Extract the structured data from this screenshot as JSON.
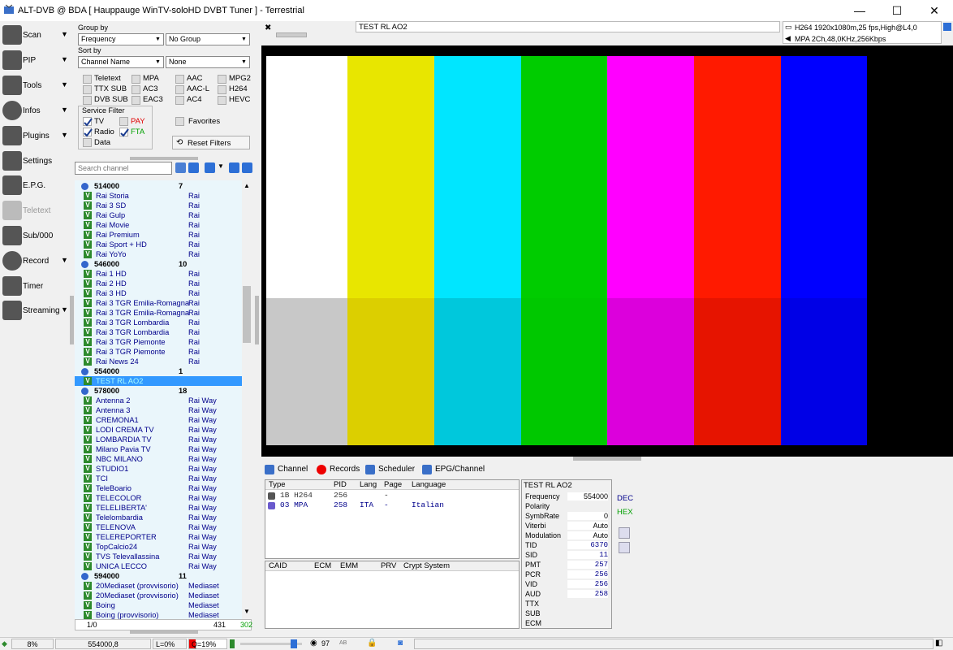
{
  "window": {
    "title": "ALT-DVB @ BDA [ Hauppauge WinTV-soloHD DVBT Tuner ] - Terrestrial",
    "minimize": "—",
    "maximize": "☐",
    "close": "✕"
  },
  "left_panel": [
    {
      "label": "Scan",
      "icon": "satellite-dish-icon",
      "arrow": "▼"
    },
    {
      "label": "PIP",
      "icon": "monitor-icon",
      "arrow": "▼"
    },
    {
      "label": "Tools",
      "icon": "tools-icon",
      "arrow": "▼"
    },
    {
      "label": "Infos",
      "icon": "info-icon",
      "arrow": "▼"
    },
    {
      "label": "Plugins",
      "icon": "plugin-icon",
      "arrow": "▼"
    },
    {
      "label": "Settings",
      "icon": "gear-icon",
      "arrow": ""
    },
    {
      "label": "E.P.G.",
      "icon": "epg-icon",
      "arrow": ""
    },
    {
      "label": "Teletext",
      "icon": "teletext-icon",
      "arrow": ""
    },
    {
      "label": "Sub/000",
      "icon": "subtitle-icon",
      "arrow": ""
    },
    {
      "label": "Record",
      "icon": "record-icon",
      "arrow": "▼"
    },
    {
      "label": "Timer",
      "icon": "clock-icon",
      "arrow": ""
    },
    {
      "label": "Streaming",
      "icon": "network-icon",
      "arrow": "▼"
    }
  ],
  "filters": {
    "group_by_label": "Group by",
    "group_by_value": "Frequency",
    "group_by2_value": "No Group",
    "sort_by_label": "Sort by",
    "sort_by_value": "Channel Name",
    "sort_by2_value": "None",
    "checkboxes": [
      "Teletext",
      "MPA",
      "AAC",
      "MPG2",
      "TTX SUB",
      "AC3",
      "AAC-L",
      "H264",
      "DVB SUB",
      "EAC3",
      "AC4",
      "HEVC"
    ],
    "service_filter_label": "Service Filter",
    "tv": "TV",
    "pay": "PAY",
    "radio": "Radio",
    "fta": "FTA",
    "data": "Data",
    "favorites": "Favorites",
    "reset": "Reset Filters"
  },
  "search": {
    "placeholder": "Search channel"
  },
  "channels": [
    {
      "type": "group",
      "name": "514000",
      "count": "7"
    },
    {
      "name": "Rai  Storia",
      "provider": "Rai"
    },
    {
      "name": "Rai 3 SD",
      "provider": "Rai"
    },
    {
      "name": "Rai Gulp",
      "provider": "Rai"
    },
    {
      "name": "Rai Movie",
      "provider": "Rai"
    },
    {
      "name": "Rai Premium",
      "provider": "Rai"
    },
    {
      "name": "Rai Sport + HD",
      "provider": "Rai"
    },
    {
      "name": "Rai YoYo",
      "provider": "Rai"
    },
    {
      "type": "group",
      "name": "546000",
      "count": "10"
    },
    {
      "name": "Rai 1 HD",
      "provider": "Rai"
    },
    {
      "name": "Rai 2 HD",
      "provider": "Rai"
    },
    {
      "name": "Rai 3 HD",
      "provider": "Rai"
    },
    {
      "name": "Rai 3 TGR Emilia-Romagna",
      "provider": "Rai"
    },
    {
      "name": "Rai 3 TGR Emilia-Romagna",
      "provider": "Rai"
    },
    {
      "name": "Rai 3 TGR Lombardia",
      "provider": "Rai"
    },
    {
      "name": "Rai 3 TGR Lombardia",
      "provider": "Rai"
    },
    {
      "name": "Rai 3 TGR Piemonte",
      "provider": "Rai"
    },
    {
      "name": "Rai 3 TGR Piemonte",
      "provider": "Rai"
    },
    {
      "name": "Rai News 24",
      "provider": "Rai"
    },
    {
      "type": "group",
      "name": "554000",
      "count": "1"
    },
    {
      "name": "TEST RL AO2",
      "provider": "",
      "selected": true
    },
    {
      "type": "group",
      "name": "578000",
      "count": "18"
    },
    {
      "name": "Antenna 2",
      "provider": "Rai Way"
    },
    {
      "name": "Antenna 3",
      "provider": "Rai Way"
    },
    {
      "name": "CREMONA1",
      "provider": "Rai Way"
    },
    {
      "name": "LODI CREMA TV",
      "provider": "Rai Way"
    },
    {
      "name": "LOMBARDIA TV",
      "provider": "Rai Way"
    },
    {
      "name": "Milano Pavia TV",
      "provider": "Rai Way"
    },
    {
      "name": "NBC MILANO",
      "provider": "Rai Way"
    },
    {
      "name": "STUDIO1",
      "provider": "Rai Way"
    },
    {
      "name": "TCI",
      "provider": "Rai Way"
    },
    {
      "name": "TeleBoario",
      "provider": "Rai Way"
    },
    {
      "name": "TELECOLOR",
      "provider": "Rai Way"
    },
    {
      "name": "TELELIBERTA'",
      "provider": "Rai Way"
    },
    {
      "name": "Telelombardia",
      "provider": "Rai Way"
    },
    {
      "name": "TELENOVA",
      "provider": "Rai Way"
    },
    {
      "name": "TELEREPORTER",
      "provider": "Rai Way"
    },
    {
      "name": "TopCalcio24",
      "provider": "Rai Way"
    },
    {
      "name": "TVS Televallassina",
      "provider": "Rai Way"
    },
    {
      "name": "UNICA LECCO",
      "provider": "Rai Way"
    },
    {
      "type": "group",
      "name": "594000",
      "count": "11"
    },
    {
      "name": "20Mediaset (provvisorio)",
      "provider": "Mediaset"
    },
    {
      "name": "20Mediaset (provvisorio)",
      "provider": "Mediaset"
    },
    {
      "name": "Boing",
      "provider": "Mediaset"
    },
    {
      "name": "Boing (provvisorio)",
      "provider": "Mediaset"
    }
  ],
  "list_status": {
    "position": "1/0",
    "total": "431",
    "fta": "302"
  },
  "video_info": {
    "channel": "TEST RL AO2",
    "video": "H264 1920x1080m,25 fps,High@L4,0",
    "audio": "MPA 2Ch,48,0KHz,256Kbps"
  },
  "colorbars": {
    "top": [
      "#ffffff",
      "#e8e600",
      "#00e6ff",
      "#00cc00",
      "#ff00ff",
      "#ff1a00",
      "#0000ff",
      "#000000"
    ],
    "bottom": [
      "#c8c8c8",
      "#dccf00",
      "#00c8dc",
      "#00c800",
      "#dc00dc",
      "#e61400",
      "#0000e6",
      "#000000"
    ]
  },
  "tabs": [
    "Channel",
    "Records",
    "Scheduler",
    "EPG/Channel"
  ],
  "streams": {
    "headers": [
      "Type",
      "PID",
      "Lang",
      "Page",
      "Language"
    ],
    "rows": [
      {
        "type": "1B H264",
        "pid": "256",
        "lang": "",
        "page": "-",
        "language": ""
      },
      {
        "type": "03 MPA",
        "pid": "258",
        "lang": "ITA",
        "page": "-",
        "language": "Italian"
      }
    ]
  },
  "ca": {
    "headers": [
      "CAID",
      "ECM",
      "EMM",
      "PRV",
      "Crypt System"
    ]
  },
  "channel_info": {
    "title": "TEST RL AO2",
    "fields": [
      {
        "k": "Frequency",
        "v": "554000"
      },
      {
        "k": "Polarity",
        "v": ""
      },
      {
        "k": "SymbRate",
        "v": "0"
      },
      {
        "k": "Viterbi",
        "v": "Auto"
      },
      {
        "k": "Modulation",
        "v": "Auto"
      },
      {
        "k": "TID",
        "v": "6370"
      },
      {
        "k": "SID",
        "v": "11"
      },
      {
        "k": "PMT",
        "v": "257"
      },
      {
        "k": "PCR",
        "v": "256"
      },
      {
        "k": "VID",
        "v": "256"
      },
      {
        "k": "AUD",
        "v": "258"
      },
      {
        "k": "TTX",
        "v": ""
      },
      {
        "k": "SUB",
        "v": ""
      },
      {
        "k": "ECM",
        "v": ""
      }
    ],
    "dec": "DEC",
    "hex": "HEX"
  },
  "statusbar": {
    "signal": "8%",
    "freq": "554000,8",
    "level": "L=0%",
    "quality": "Q=19%",
    "volume": "97",
    "ab": "AB"
  }
}
